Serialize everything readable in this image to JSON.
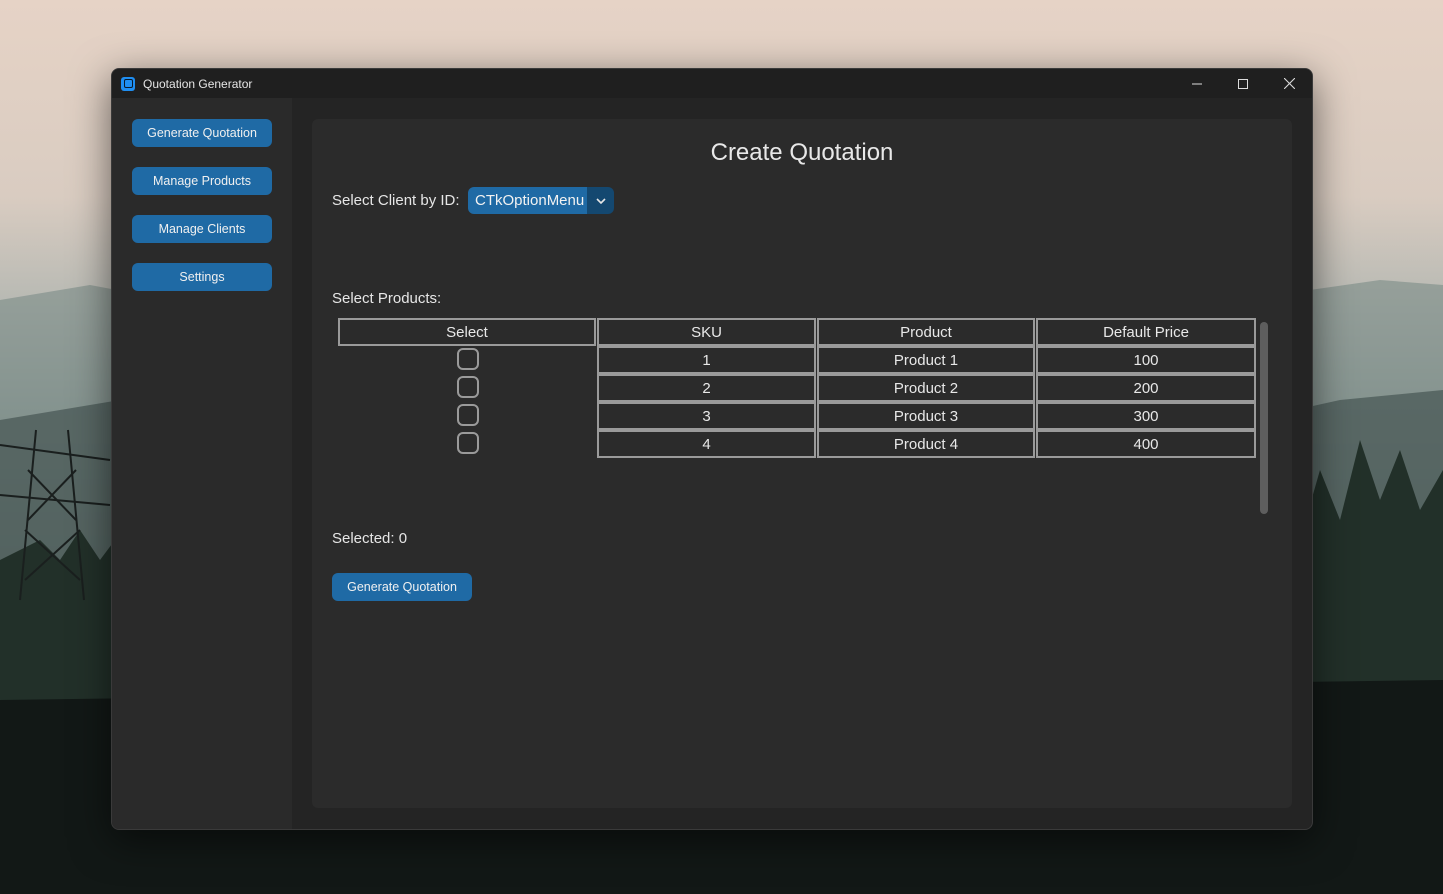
{
  "window": {
    "title": "Quotation Generator",
    "controls": [
      "minimize",
      "maximize",
      "close"
    ]
  },
  "sidebar": {
    "items": [
      {
        "label": "Generate Quotation"
      },
      {
        "label": "Manage Products"
      },
      {
        "label": "Manage Clients"
      },
      {
        "label": "Settings"
      }
    ]
  },
  "main": {
    "title": "Create Quotation",
    "client_label": "Select Client by ID:",
    "client_option": "CTkOptionMenu",
    "products_label": "Select Products:",
    "table": {
      "headers": [
        "Select",
        "SKU",
        "Product",
        "Default Price"
      ],
      "rows": [
        {
          "sku": "1",
          "product": "Product 1",
          "price": "100",
          "checked": false
        },
        {
          "sku": "2",
          "product": "Product 2",
          "price": "200",
          "checked": false
        },
        {
          "sku": "3",
          "product": "Product 3",
          "price": "300",
          "checked": false
        },
        {
          "sku": "4",
          "product": "Product 4",
          "price": "400",
          "checked": false
        }
      ]
    },
    "selected_text": "Selected: 0",
    "generate_button": "Generate Quotation"
  },
  "colors": {
    "accent": "#1f6aa5",
    "accent_dark": "#144870",
    "panel": "#2b2b2b",
    "sidebar": "#2a2a2a"
  }
}
